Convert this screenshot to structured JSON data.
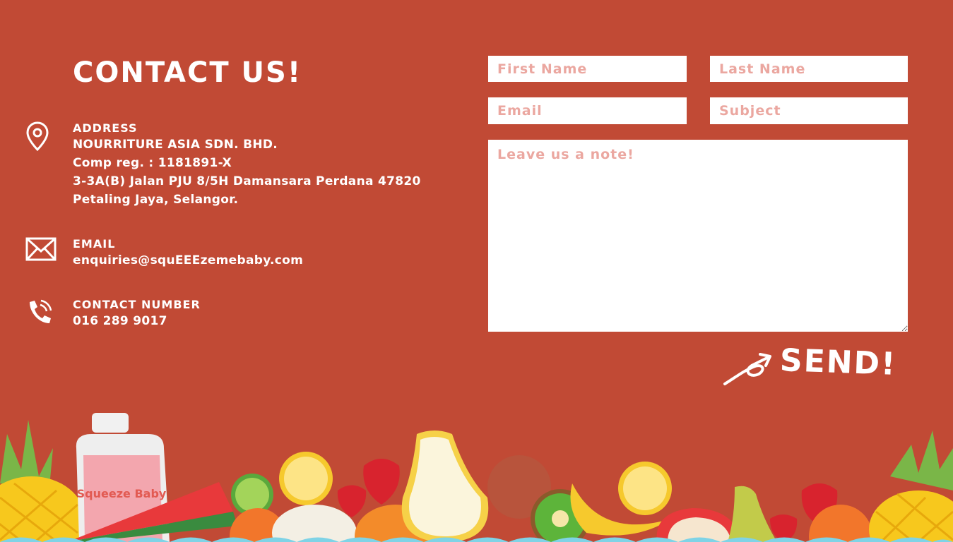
{
  "header": {
    "title": "CONTACT US!"
  },
  "contact_info": {
    "address": {
      "label": "ADDRESS",
      "lines": [
        "NOURRITURE ASIA SDN. BHD.",
        "Comp reg. : 1181891-X",
        "3-3A(B) Jalan PJU 8/5H Damansara Perdana 47820",
        "Petaling Jaya, Selangor."
      ],
      "icon": "location-pin-icon"
    },
    "email": {
      "label": "EMAIL",
      "value": "enquiries@squEEEzemebaby.com",
      "icon": "envelope-icon"
    },
    "phone": {
      "label": "CONTACT NUMBER",
      "value": "016 289 9017",
      "icon": "phone-icon"
    }
  },
  "form": {
    "first_name": {
      "placeholder": "First Name",
      "value": ""
    },
    "last_name": {
      "placeholder": "Last Name",
      "value": ""
    },
    "email": {
      "placeholder": "Email",
      "value": ""
    },
    "subject": {
      "placeholder": "Subject",
      "value": ""
    },
    "note": {
      "placeholder": "Leave us a note!",
      "value": ""
    },
    "send_label": "SEND!"
  },
  "decoration": {
    "product_logo_text": "Squeeze Baby",
    "colors": {
      "background": "#c14a35",
      "placeholder": "#eba7a0"
    }
  }
}
